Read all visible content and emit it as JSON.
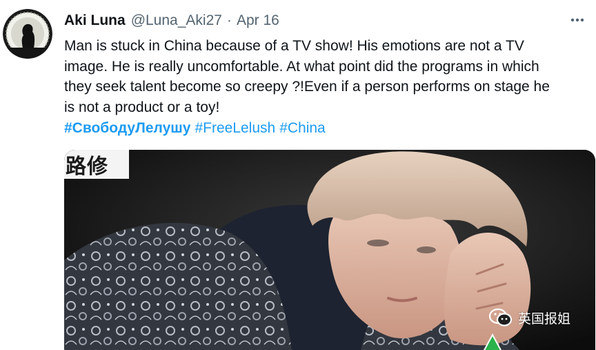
{
  "author": {
    "display_name": "Aki Luna",
    "handle": "@Luna_Aki27",
    "separator": "·",
    "date": "Apr 16"
  },
  "tweet": {
    "lines": [
      "Man is stuck in China because of a TV show! His emotions are not a TV",
      "image. He is really uncomfortable. At what point did the programs in which",
      "they seek talent become so creepy ?!Even if a person performs on stage he",
      "is not a product or a toy!"
    ],
    "hashtags": [
      "#СвободуЛелушу",
      "#FreeLelush",
      "#China"
    ]
  },
  "media": {
    "caption_text": "路修",
    "watermark_text": "英国报姐"
  },
  "colors": {
    "link": "#1d9bf0",
    "text": "#0f1419",
    "secondary": "#536471"
  },
  "icons": {
    "more": "more-options-icon",
    "watermark": "wechat-icon"
  }
}
